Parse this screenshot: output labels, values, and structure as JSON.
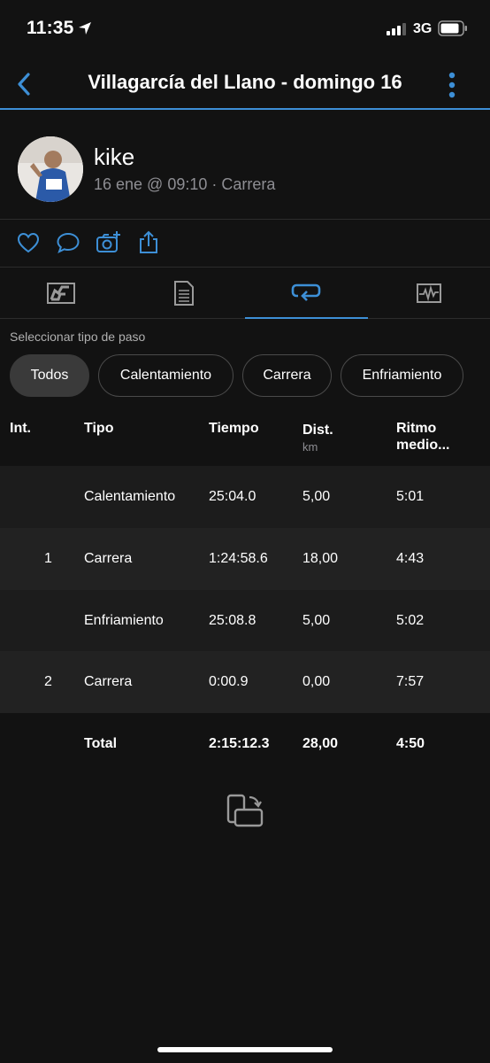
{
  "status_bar": {
    "time": "11:35",
    "network": "3G"
  },
  "nav": {
    "title": "Villagarcía del Llano - domingo 16",
    "back_icon": "chevron-left-icon",
    "more_icon": "vertical-ellipsis-icon"
  },
  "profile": {
    "name": "kike",
    "meta": "16 ene @ 09:10 · Carrera"
  },
  "actions": [
    "heart-icon",
    "comment-icon",
    "add-photo-icon",
    "share-icon"
  ],
  "tabs": [
    {
      "icon": "map-chart-icon",
      "active": false
    },
    {
      "icon": "details-document-icon",
      "active": false
    },
    {
      "icon": "laps-loop-icon",
      "active": true
    },
    {
      "icon": "graph-icon",
      "active": false
    }
  ],
  "filter": {
    "label": "Seleccionar tipo de paso",
    "chips": [
      "Todos",
      "Calentamiento",
      "Carrera",
      "Enfriamiento"
    ],
    "selected": "Todos"
  },
  "table": {
    "headers": {
      "int": "Int.",
      "tipo": "Tipo",
      "tiempo": "Tiempo",
      "dist": "Dist.",
      "dist_unit": "km",
      "ritmo_line1": "Ritmo",
      "ritmo_line2": "medio..."
    },
    "rows": [
      {
        "int": "",
        "tipo": "Calentamiento",
        "tiempo": "25:04.0",
        "dist": "5,00",
        "ritmo": "5:01"
      },
      {
        "int": "1",
        "tipo": "Carrera",
        "tiempo": "1:24:58.6",
        "dist": "18,00",
        "ritmo": "4:43"
      },
      {
        "int": "",
        "tipo": "Enfriamiento",
        "tiempo": "25:08.8",
        "dist": "5,00",
        "ritmo": "5:02"
      },
      {
        "int": "2",
        "tipo": "Carrera",
        "tiempo": "0:00.9",
        "dist": "0,00",
        "ritmo": "7:57"
      }
    ],
    "total": {
      "tipo": "Total",
      "tiempo": "2:15:12.3",
      "dist": "28,00",
      "ritmo": "4:50"
    }
  },
  "colors": {
    "background": "#121212",
    "accent": "#3d8fd6",
    "row_shade": "#1c1c1c",
    "secondary_text": "#8e8e93"
  }
}
